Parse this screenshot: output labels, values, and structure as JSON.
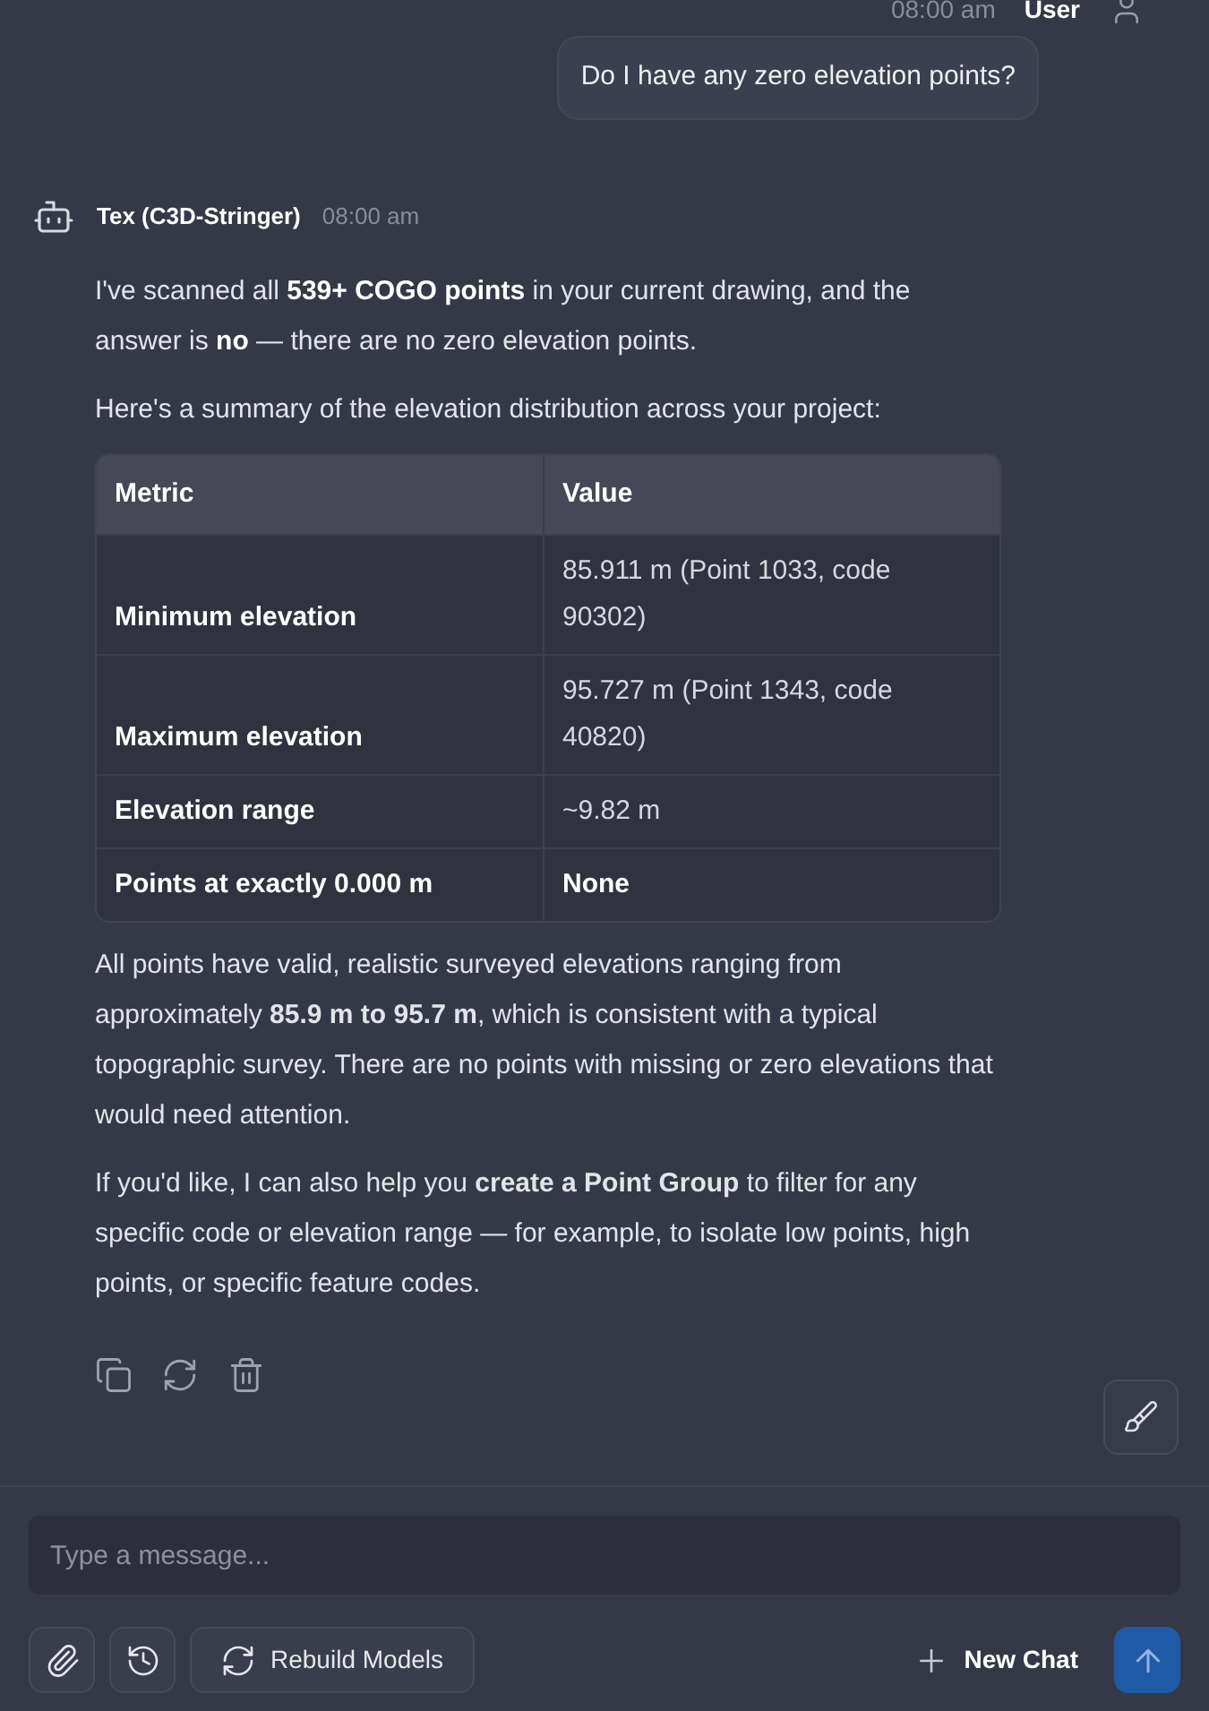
{
  "user_message": {
    "time": "08:00 am",
    "author": "User",
    "text": "Do I have any zero elevation points?"
  },
  "assistant_message": {
    "author": "Tex (C3D-Stringer)",
    "time": "08:00 am",
    "intro": [
      "I've scanned all **539+ COGO points** in your current drawing, and the answer is **no** — there are no zero elevation points.",
      "Here's a summary of the elevation distribution across your project:"
    ],
    "table": {
      "columns": [
        "Metric",
        "Value"
      ],
      "rows": [
        {
          "metric": "Minimum elevation",
          "value": "85.911 m (Point 1033, code 90302)",
          "value_bold": false
        },
        {
          "metric": "Maximum elevation",
          "value": "95.727 m (Point 1343, code 40820)",
          "value_bold": false
        },
        {
          "metric": "Elevation range",
          "value": "~9.82 m",
          "value_bold": false
        },
        {
          "metric": "Points at exactly 0.000 m",
          "value": "None",
          "value_bold": true
        }
      ]
    },
    "outro": [
      "All points have valid, realistic surveyed elevations ranging from approximately **85.9 m to 95.7 m**, which is consistent with a typical topographic survey. There are no points with missing or zero elevations that would need attention.",
      "If you'd like, I can also help you **create a Point Group** to filter for any specific code or elevation range — for example, to isolate low points, high points, or specific feature codes."
    ]
  },
  "composer": {
    "placeholder": "Type a message...",
    "rebuild_label": "Rebuild Models",
    "new_chat_label": "New Chat"
  }
}
